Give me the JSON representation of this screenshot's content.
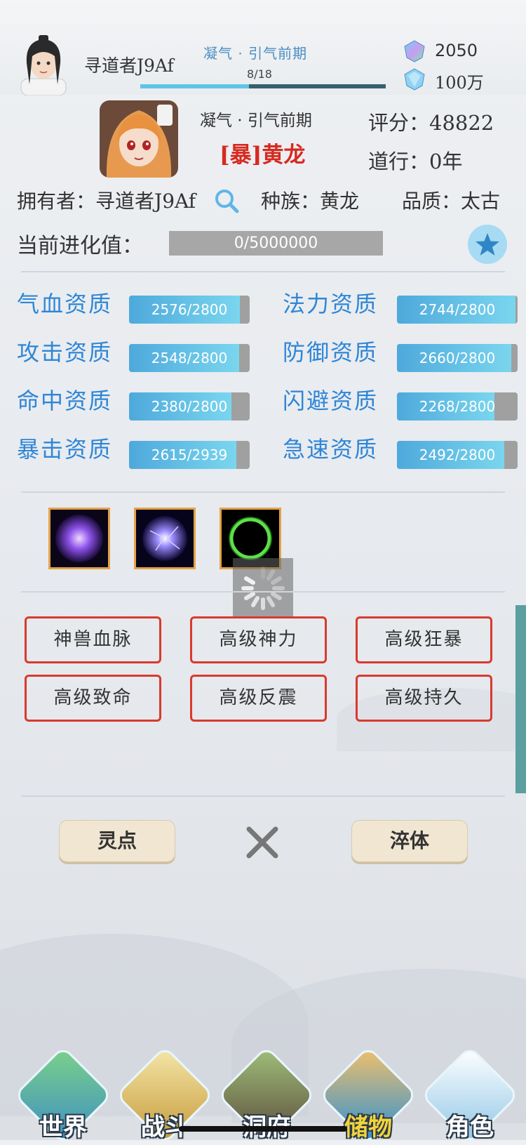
{
  "header": {
    "player_name": "寻道者J9Af",
    "realm": "凝气 · 引气前期",
    "exp_text": "8/18",
    "exp_progress": 0.444,
    "jade": "2050",
    "gold": "100万"
  },
  "pet": {
    "realm": "凝气 · 引气前期",
    "name": "[暴]黄龙",
    "score_label": "评分：48822",
    "dao_label": "道行：0年",
    "owner_label": "拥有者：寻道者J9Af",
    "race_label": "种族：黄龙",
    "quality_label": "品质：太古",
    "evolution_label": "当前进化值：",
    "evolution_value": "0/5000000",
    "evolution_progress": 0
  },
  "stats": [
    {
      "label": "气血资质",
      "value": "2576/2800",
      "progress": 0.92
    },
    {
      "label": "法力资质",
      "value": "2744/2800",
      "progress": 0.98
    },
    {
      "label": "攻击资质",
      "value": "2548/2800",
      "progress": 0.91
    },
    {
      "label": "防御资质",
      "value": "2660/2800",
      "progress": 0.95
    },
    {
      "label": "命中资质",
      "value": "2380/2800",
      "progress": 0.85
    },
    {
      "label": "闪避资质",
      "value": "2268/2800",
      "progress": 0.81
    },
    {
      "label": "暴击资质",
      "value": "2615/2939",
      "progress": 0.89
    },
    {
      "label": "急速资质",
      "value": "2492/2800",
      "progress": 0.89
    }
  ],
  "skills": [
    {
      "icon": "purple-vortex-icon"
    },
    {
      "icon": "purple-lightning-orb-icon"
    },
    {
      "icon": "green-ring-icon"
    }
  ],
  "traits": [
    "神兽血脉",
    "高级神力",
    "高级狂暴",
    "高级致命",
    "高级反震",
    "高级持久"
  ],
  "actions": {
    "left": "灵点",
    "right": "淬体"
  },
  "nav": [
    {
      "label": "世界",
      "icon": "world-icon",
      "active": false
    },
    {
      "label": "战斗",
      "icon": "battle-icon",
      "active": false
    },
    {
      "label": "洞府",
      "icon": "cave-icon",
      "active": false
    },
    {
      "label": "储物",
      "icon": "storage-icon",
      "active": true
    },
    {
      "label": "角色",
      "icon": "character-icon",
      "active": false
    }
  ],
  "colors": {
    "accent_blue": "#2f86d6",
    "trait_border": "#d83a2e",
    "pet_name": "#d62a20",
    "nav_active": "#f2d43b"
  }
}
